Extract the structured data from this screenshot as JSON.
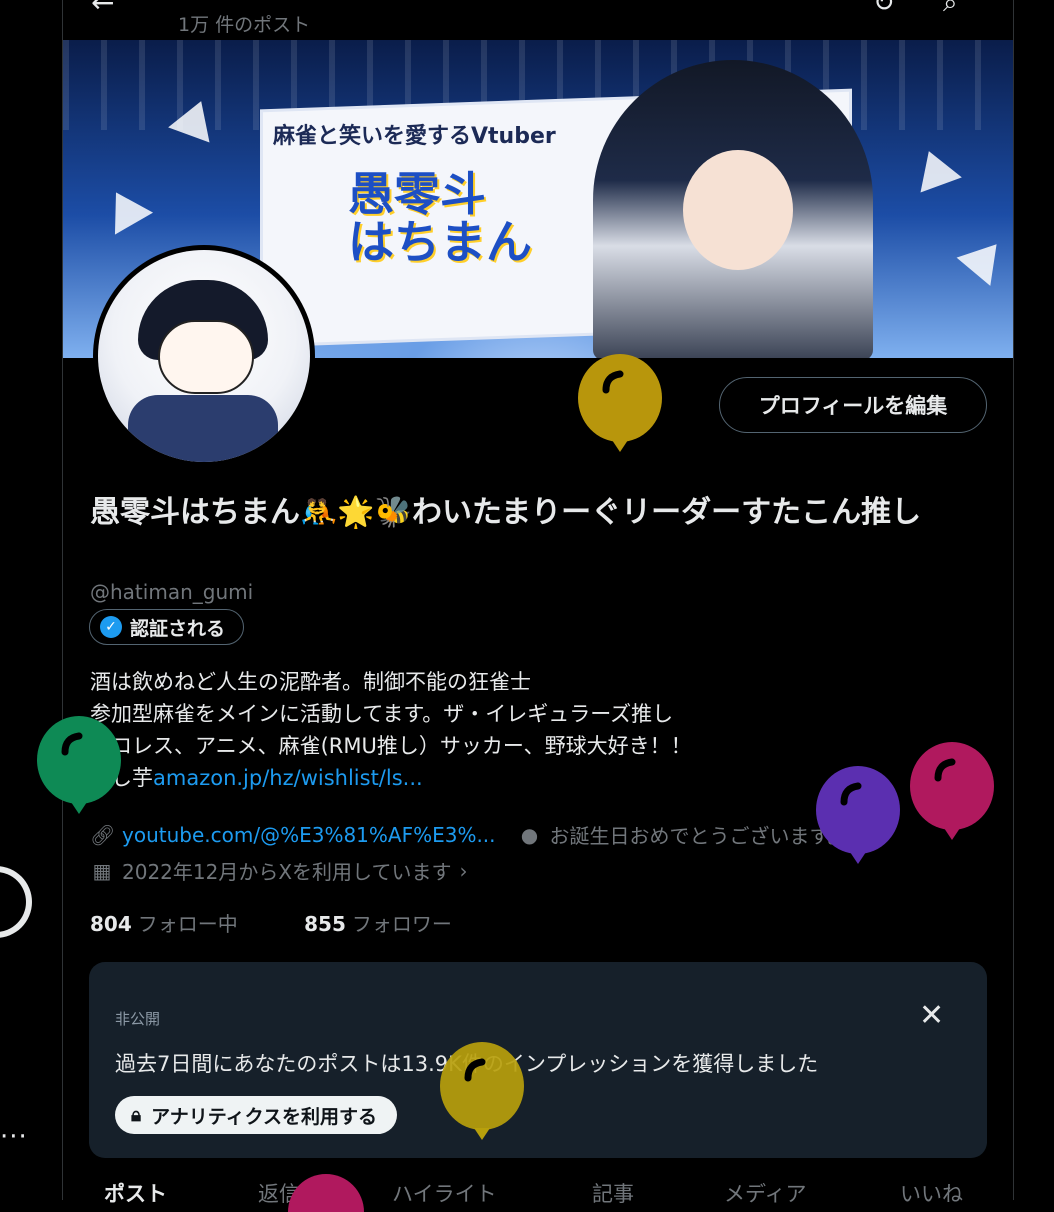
{
  "header": {
    "post_count": "1万 件のポスト"
  },
  "banner": {
    "tagline": "麻雀と笑いを愛するVtuber",
    "logo_line1": "愚零斗",
    "logo_line2": "はちまん"
  },
  "profile": {
    "edit_button": "プロフィールを編集",
    "display_name": "愚零斗はちまん🤼🌟🐝わいたまりーぐリーダーすたこん推し",
    "handle": "@hatiman_gumi",
    "verify_label": "認証される",
    "bio_line1": "酒は飲めねど人生の泥酔者。制御不能の狂雀士",
    "bio_line2": "参加型麻雀をメインに活動してます。ザ・イレギュラーズ推し",
    "bio_line3": "プロレス、アニメ、麻雀(RMU推し）サッカー、野球大好き！！",
    "bio_line4_prefix": "干し芋",
    "bio_link": "amazon.jp/hz/wishlist/ls...",
    "website": "youtube.com/@%E3%81%AF%E3%...",
    "birthday": "お誕生日おめでとうございます。",
    "joined": "2022年12月からXを利用しています",
    "following_count": "804",
    "following_label": "フォロー中",
    "followers_count": "855",
    "followers_label": "フォロワー"
  },
  "analytics_card": {
    "label": "非公開",
    "message": "過去7日間にあなたのポストは13.9K件のインプレッションを獲得しました",
    "button": "アナリティクスを利用する"
  },
  "tabs": [
    "ポスト",
    "返信",
    "ハイライト",
    "記事",
    "メディア",
    "いいね"
  ],
  "icons": [
    "back-arrow-icon",
    "refresh-icon",
    "search-icon",
    "verified-badge-icon",
    "link-icon",
    "balloon-icon",
    "calendar-icon",
    "chevron-right-icon",
    "close-icon",
    "lock-icon",
    "more-icon"
  ],
  "colors": {
    "accent": "#1d9bf0",
    "background": "#000000",
    "card_background": "#16202a",
    "balloon_yellow": "#b8960c",
    "balloon_green": "#0e8a55",
    "balloon_purple": "#5b2fb0",
    "balloon_magenta": "#b0195e"
  }
}
